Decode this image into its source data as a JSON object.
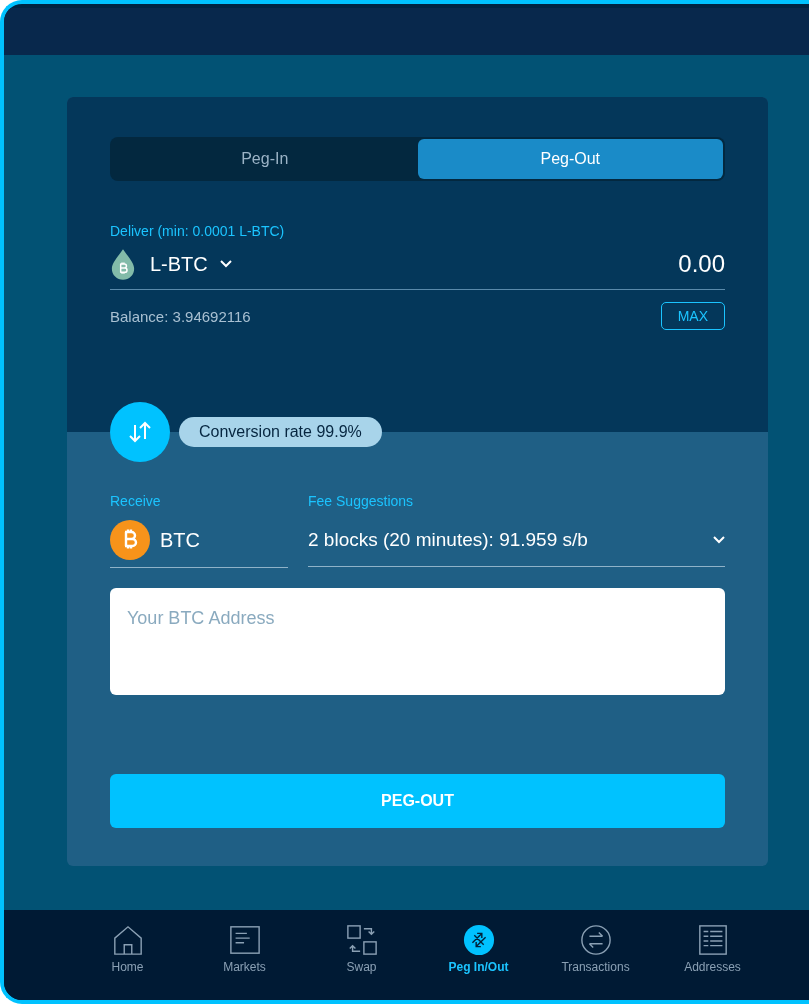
{
  "tabs": [
    {
      "label": "Peg-In",
      "selected": false
    },
    {
      "label": "Peg-Out",
      "selected": true
    }
  ],
  "deliver": {
    "label": "Deliver (min: 0.0001 L-BTC)",
    "asset": "L-BTC",
    "amount": "0.00",
    "balance": "Balance: 3.94692116",
    "max_button": "MAX"
  },
  "conversion_rate": "Conversion rate 99.9%",
  "receive": {
    "label": "Receive",
    "asset": "BTC"
  },
  "fee": {
    "label": "Fee Suggestions",
    "value": "2 blocks (20 minutes): 91.959 s/b"
  },
  "address": {
    "placeholder": "Your BTC Address"
  },
  "submit_button": "PEG-OUT",
  "nav": [
    {
      "label": "Home",
      "kind": "home",
      "selected": false
    },
    {
      "label": "Markets",
      "kind": "markets",
      "selected": false
    },
    {
      "label": "Swap",
      "kind": "swap",
      "selected": false
    },
    {
      "label": "Peg In/Out",
      "kind": "peg",
      "selected": true
    },
    {
      "label": "Transactions",
      "kind": "transactions",
      "selected": false
    },
    {
      "label": "Addresses",
      "kind": "addresses",
      "selected": false
    }
  ]
}
